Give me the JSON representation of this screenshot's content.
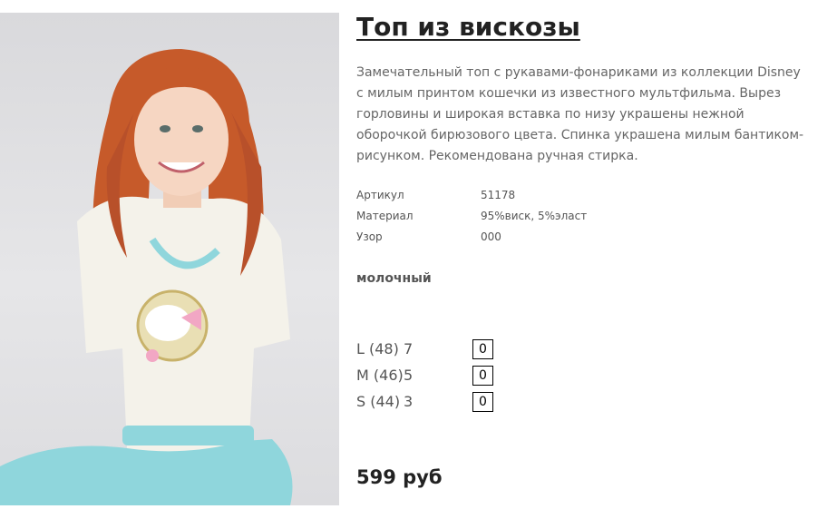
{
  "product": {
    "title": "Топ из вискозы",
    "description": "Замечательный топ с рукавами-фонариками из коллекции Disney с милым принтом кошечки из известного мультфильма. Вырез горловины и широкая вставка по низу украшены нежной оборочкой бирюзового цвета. Спинка украшена милым бантиком-рисунком. Рекомендована ручная стирка.",
    "specs": [
      {
        "label": "Артикул",
        "value": "51178"
      },
      {
        "label": "Материал",
        "value": "95%виск, 5%эласт"
      },
      {
        "label": "Узор",
        "value": "000"
      }
    ],
    "color": "молочный",
    "sizes": [
      {
        "name": "L (48)",
        "stock": "7",
        "qty": "0"
      },
      {
        "name": "M (46)",
        "stock": "5",
        "qty": "0"
      },
      {
        "name": "S (44)",
        "stock": "3",
        "qty": "0"
      }
    ],
    "price": "599 руб"
  },
  "colors": {
    "accent_turquoise": "#8fd6dc",
    "hair": "#c65a2a",
    "top_fabric": "#f4f2ea"
  }
}
